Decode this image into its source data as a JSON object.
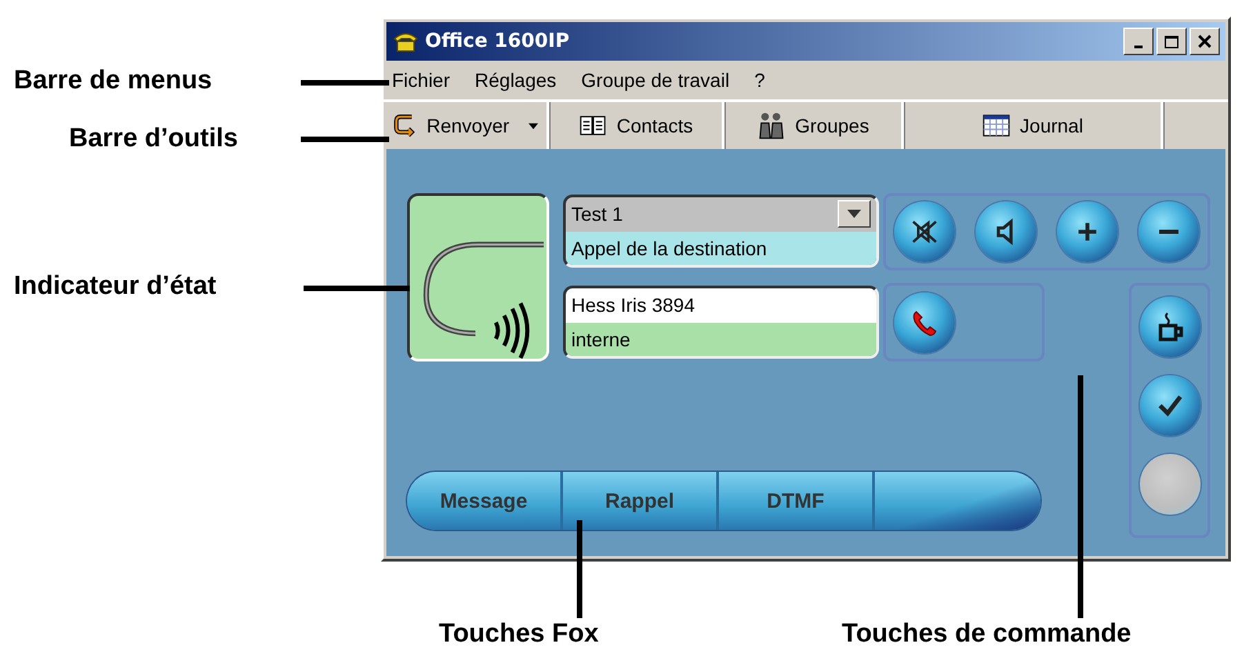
{
  "callouts": [
    {
      "label": "Barre de menus"
    },
    {
      "label": "Barre d’outils"
    },
    {
      "label": "Indicateur d’état"
    },
    {
      "label": "Touches Fox"
    },
    {
      "label": "Touches de commande"
    }
  ],
  "window": {
    "title": "Office 1600IP"
  },
  "menu": [
    "Fichier",
    "Réglages",
    "Groupe de travail",
    "?"
  ],
  "toolbar": [
    {
      "label": "Renvoyer",
      "kind": "forward"
    },
    {
      "label": "Contacts",
      "kind": "contacts"
    },
    {
      "label": "Groupes",
      "kind": "groups"
    },
    {
      "label": "Journal",
      "kind": "journal"
    }
  ],
  "lines": [
    {
      "name": "Test 1",
      "status": "Appel de la destination",
      "kind": "dropdown"
    },
    {
      "name": "Hess Iris 3894",
      "status": "interne",
      "kind": "plain"
    }
  ],
  "control_keys": {
    "top": [
      {
        "kind": "mute"
      },
      {
        "kind": "speaker"
      },
      {
        "kind": "plus"
      },
      {
        "kind": "minus"
      }
    ],
    "call": [
      {
        "kind": "hangup"
      }
    ],
    "side": [
      {
        "kind": "pause"
      },
      {
        "kind": "confirm"
      },
      {
        "kind": "blank"
      }
    ]
  },
  "fox_keys": [
    "Message",
    "Rappel",
    "DTMF"
  ]
}
